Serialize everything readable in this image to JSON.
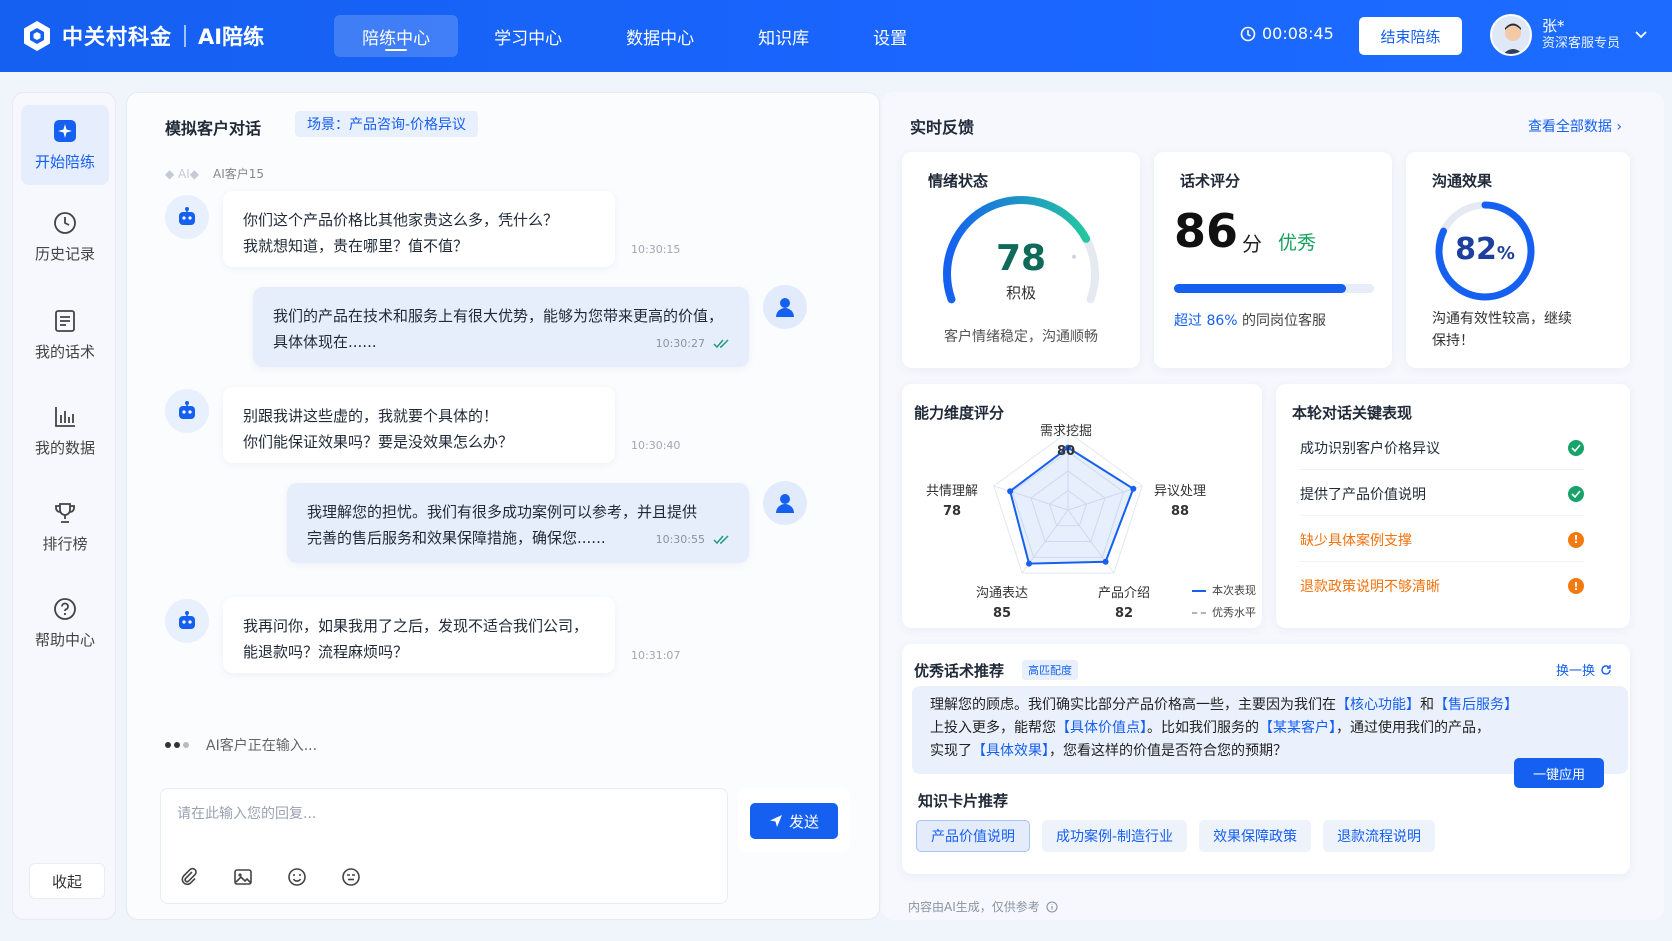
{
  "brand": {
    "name": "中关村科金",
    "sub": "AI陪练"
  },
  "nav": [
    {
      "label": "陪练中心",
      "active": true
    },
    {
      "label": "学习中心"
    },
    {
      "label": "数据中心"
    },
    {
      "label": "知识库"
    },
    {
      "label": "设置"
    }
  ],
  "header": {
    "timer": "00:08:45",
    "end_button": "结束陪练",
    "user_name": "张*",
    "user_role": "资深客服专员"
  },
  "sidebar": {
    "items": [
      {
        "label": "开始陪练",
        "icon": "practice-icon",
        "active": true
      },
      {
        "label": "历史记录",
        "icon": "clock-icon"
      },
      {
        "label": "我的话术",
        "icon": "script-icon"
      },
      {
        "label": "我的数据",
        "icon": "chart-icon"
      },
      {
        "label": "排行榜",
        "icon": "trophy-icon"
      },
      {
        "label": "帮助中心",
        "icon": "help-icon"
      }
    ],
    "collapse": "收起"
  },
  "chat": {
    "title": "模拟客户对话",
    "scene": "场景：产品咨询-价格异议",
    "ai_tag": "AI客户15",
    "messages": [
      {
        "from": "ai",
        "lines": [
          "你们这个产品价格比其他家贵这么多，凭什么？",
          "我就想知道，贵在哪里？值不值？"
        ],
        "time": "10:30:15"
      },
      {
        "from": "me",
        "lines": [
          "我们的产品在技术和服务上有很大优势，能够为您带来更高的价值，",
          "具体体现在......"
        ],
        "time": "10:30:27"
      },
      {
        "from": "ai",
        "lines": [
          "别跟我讲这些虚的，我就要个具体的！",
          "你们能保证效果吗？要是没效果怎么办？"
        ],
        "time": "10:30:40"
      },
      {
        "from": "me",
        "lines": [
          "我理解您的担忧。我们有很多成功案例可以参考，并且提供",
          "完善的售后服务和效果保障措施，确保您......"
        ],
        "time": "10:30:55"
      },
      {
        "from": "ai",
        "lines": [
          "我再问你，如果我用了之后，发现不适合我们公司，",
          "能退款吗？流程麻烦吗？"
        ],
        "time": "10:31:07"
      }
    ],
    "typing": "AI客户正在输入...",
    "input_placeholder": "请在此输入您的回复...",
    "send": "发送"
  },
  "feedback": {
    "title": "实时反馈",
    "view_all": "查看全部数据",
    "emotion": {
      "title": "情绪状态",
      "value": "78",
      "label": "积极",
      "desc": "客户情绪稳定，沟通顺畅",
      "level": 0.78
    },
    "score": {
      "title": "话术评分",
      "value": "86",
      "unit": "分",
      "grade": "优秀",
      "progress": 0.86,
      "desc_prefix": "超过 86%",
      "desc_suffix": "的同岗位客服"
    },
    "comm": {
      "title": "沟通效果",
      "value": "82",
      "unit": "%",
      "fraction": 0.82,
      "desc": "沟通有效性较高，继续保持！"
    },
    "radar": {
      "title": "能力维度评分",
      "dims": [
        {
          "name": "需求挖掘",
          "value": 80
        },
        {
          "name": "异议处理",
          "value": 88
        },
        {
          "name": "产品介绍",
          "value": 82
        },
        {
          "name": "沟通表达",
          "value": 85
        },
        {
          "name": "共情理解",
          "value": 78
        }
      ],
      "legend_current": "本次表现",
      "legend_excellent": "优秀水平"
    },
    "key": {
      "title": "本轮对话关键表现",
      "items": [
        {
          "text": "成功识别客户价格异议",
          "status": "ok"
        },
        {
          "text": "提供了产品价值说明",
          "status": "ok"
        },
        {
          "text": "缺少具体案例支撑",
          "status": "warn"
        },
        {
          "text": "退款政策说明不够清晰",
          "status": "warn"
        }
      ]
    },
    "recommend": {
      "title": "优秀话术推荐",
      "tag": "高匹配度",
      "swap": "换一换",
      "text_1": "理解您的顾虑。我们确实比部分产品价格高一些，主要因为我们在",
      "hl_1": "【核心功能】",
      "text_2": "和",
      "hl_2": "【售后服务】",
      "text_3": "上投入更多，能帮您",
      "hl_3": "【具体价值点】",
      "text_4": "。比如我们服务的",
      "hl_4": "【某某客户】",
      "text_5": "，通过使用我们的产品，",
      "text_6": "实现了",
      "hl_5": "【具体效果】",
      "text_7": "，您看这样的价值是否符合您的预期？",
      "apply": "一键应用"
    },
    "cards": {
      "title": "知识卡片推荐",
      "chips": [
        "产品价值说明",
        "成功案例-制造行业",
        "效果保障政策",
        "退款流程说明"
      ]
    },
    "note": "内容由AI生成，仅供参考"
  }
}
